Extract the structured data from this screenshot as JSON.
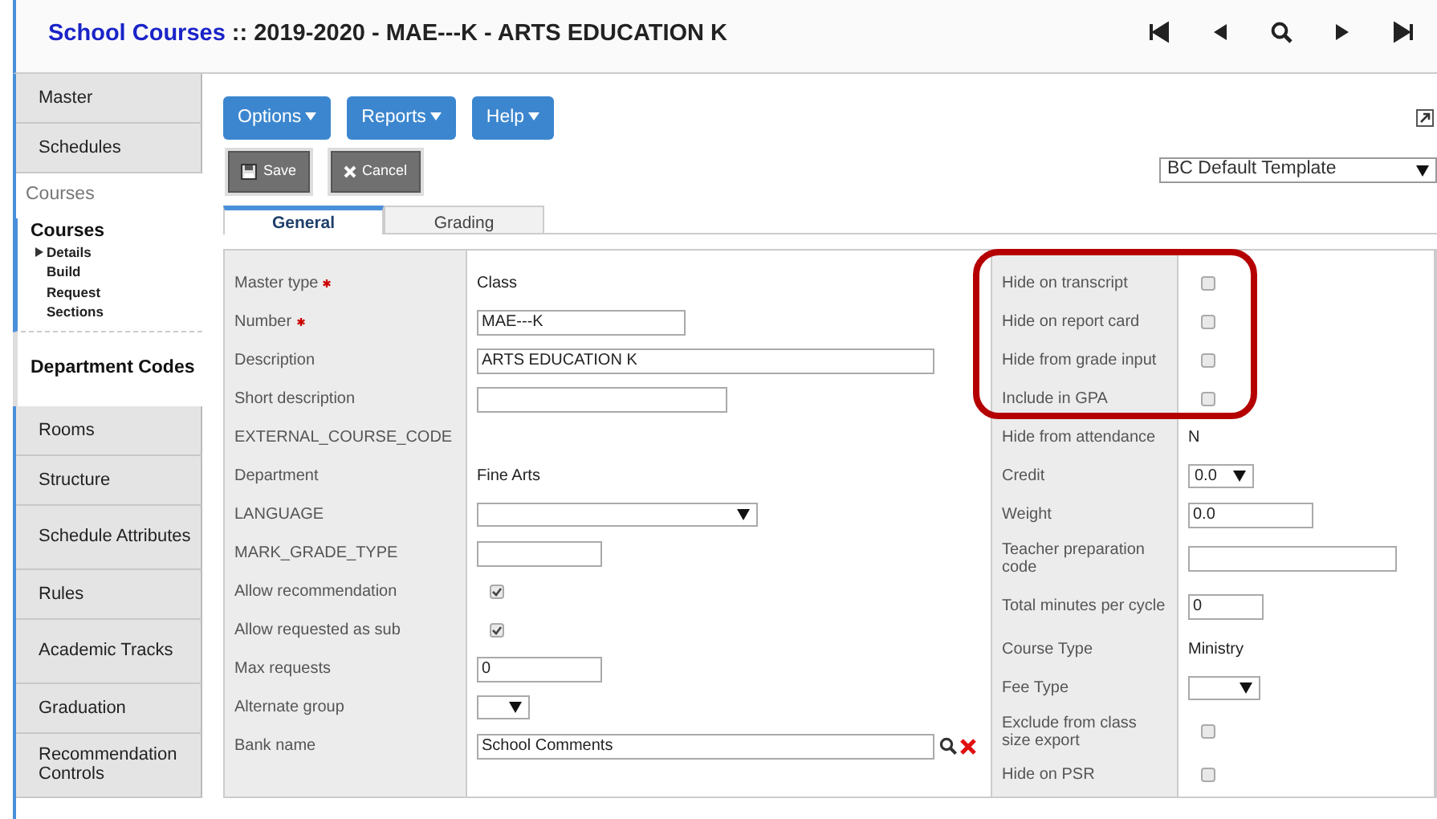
{
  "header": {
    "module": "School Courses",
    "title": " :: 2019-2020 - MAE---K - ARTS EDUCATION K"
  },
  "sidebar": [
    {
      "kind": "tab",
      "label": "Master"
    },
    {
      "kind": "tab",
      "label": "Schedules"
    },
    {
      "kind": "header",
      "label": "Courses"
    },
    {
      "kind": "group",
      "label": "Courses",
      "children": [
        {
          "label": "Details",
          "selected": true
        },
        {
          "label": "Build",
          "selected": false
        },
        {
          "label": "Request",
          "selected": false
        },
        {
          "label": "Sections",
          "selected": false
        }
      ]
    },
    {
      "kind": "section",
      "label": "Department Codes"
    },
    {
      "kind": "tab",
      "label": "Rooms"
    },
    {
      "kind": "tab",
      "label": "Structure"
    },
    {
      "kind": "tab",
      "label": "Schedule Attributes"
    },
    {
      "kind": "tab",
      "label": "Rules"
    },
    {
      "kind": "tab",
      "label": "Academic Tracks"
    },
    {
      "kind": "tab",
      "label": "Graduation"
    },
    {
      "kind": "tab",
      "label": "Recommendation Controls"
    }
  ],
  "menus": [
    "Options",
    "Reports",
    "Help"
  ],
  "actions": [
    {
      "kind": "save",
      "label": "Save"
    },
    {
      "kind": "cancel",
      "label": "Cancel"
    }
  ],
  "template": "BC Default Template",
  "tabs": [
    {
      "label": "General",
      "selected": true
    },
    {
      "label": "Grading",
      "selected": false
    }
  ],
  "left_fields": [
    {
      "label": "Master type",
      "required": true,
      "kind": "value",
      "value": "Class"
    },
    {
      "label": "Number",
      "required": true,
      "kind": "input",
      "value": "MAE---K"
    },
    {
      "label": "Description",
      "required": false,
      "kind": "input",
      "value": "ARTS EDUCATION K"
    },
    {
      "label": "Short description",
      "required": false,
      "kind": "input"
    },
    {
      "label": "EXTERNAL_COURSE_CODE",
      "required": false,
      "kind": "none"
    },
    {
      "label": "Department",
      "required": false,
      "kind": "value",
      "value": "Fine Arts"
    },
    {
      "label": "LANGUAGE",
      "required": false,
      "kind": "select"
    },
    {
      "label": "MARK_GRADE_TYPE",
      "required": false,
      "kind": "input"
    },
    {
      "label": "Allow recommendation",
      "required": false,
      "kind": "check",
      "checked": true
    },
    {
      "label": "Allow requested as sub",
      "required": false,
      "kind": "check",
      "checked": true
    },
    {
      "label": "Max requests",
      "required": false,
      "kind": "input",
      "value": "0"
    },
    {
      "label": "Alternate group",
      "required": false,
      "kind": "select"
    },
    {
      "label": "Bank name",
      "required": false,
      "kind": "lookup",
      "value": "School Comments"
    }
  ],
  "right_fields": [
    {
      "label": "Hide on transcript",
      "kind": "check",
      "checked": false
    },
    {
      "label": "Hide on report card",
      "kind": "check",
      "checked": false
    },
    {
      "label": "Hide from grade input",
      "kind": "check",
      "checked": false
    },
    {
      "label": "Include in GPA",
      "kind": "check",
      "checked": false
    },
    {
      "label": "Hide from attendance",
      "kind": "value",
      "value": "N"
    },
    {
      "label": "Credit",
      "kind": "select",
      "value": "0.0"
    },
    {
      "label": "Weight",
      "kind": "input",
      "value": "0.0"
    },
    {
      "label": "Teacher preparation code",
      "kind": "input"
    },
    {
      "label": "Total minutes per cycle",
      "kind": "input",
      "value": "0"
    },
    {
      "label": "Course Type",
      "kind": "value",
      "value": "Ministry"
    },
    {
      "label": "Fee Type",
      "kind": "select"
    },
    {
      "label": "Exclude from class size export",
      "kind": "check",
      "checked": false
    },
    {
      "label": "Hide on PSR",
      "kind": "check",
      "checked": false
    }
  ]
}
